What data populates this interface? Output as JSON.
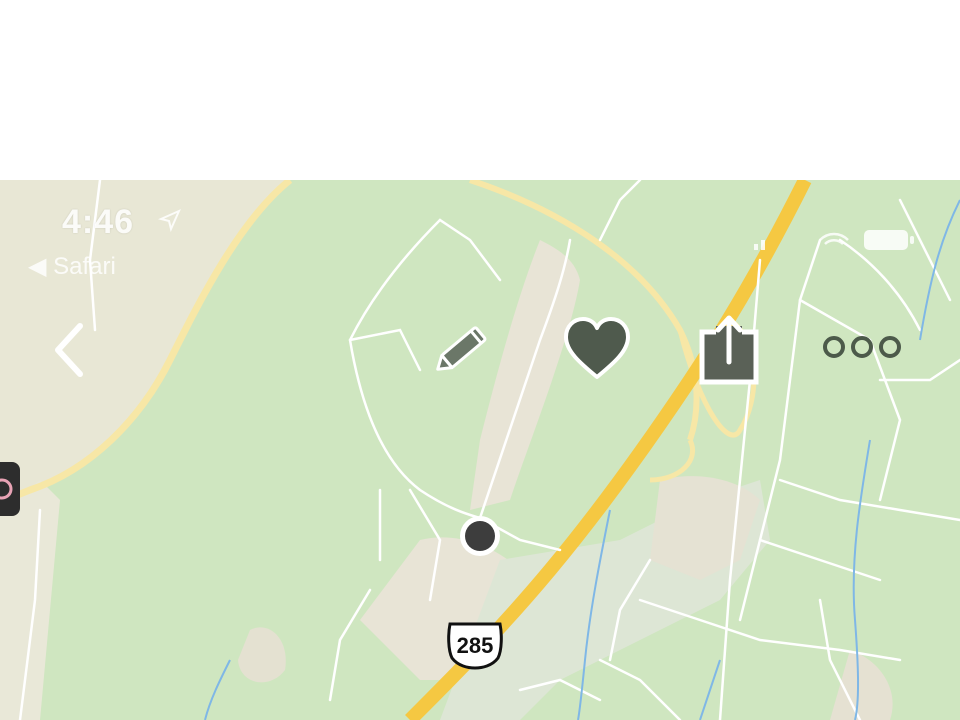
{
  "status_bar": {
    "time": "4:46",
    "back_app": "◀ Safari"
  },
  "toolbar": {
    "back_icon": "chevron-left-icon",
    "edit_icon": "pencil-icon",
    "favorite_icon": "heart-icon",
    "share_icon": "share-icon",
    "more_icon": "more-icon"
  },
  "map": {
    "highway_shield": "285",
    "current_location_marker": "location-dot",
    "colors": {
      "land": "#cfe6c0",
      "highway": "#f5c842",
      "minor_road": "#ffffff",
      "secondary_road": "#f7e7a6",
      "water": "#7fb7e6",
      "urban": "#e8e4d6"
    }
  }
}
